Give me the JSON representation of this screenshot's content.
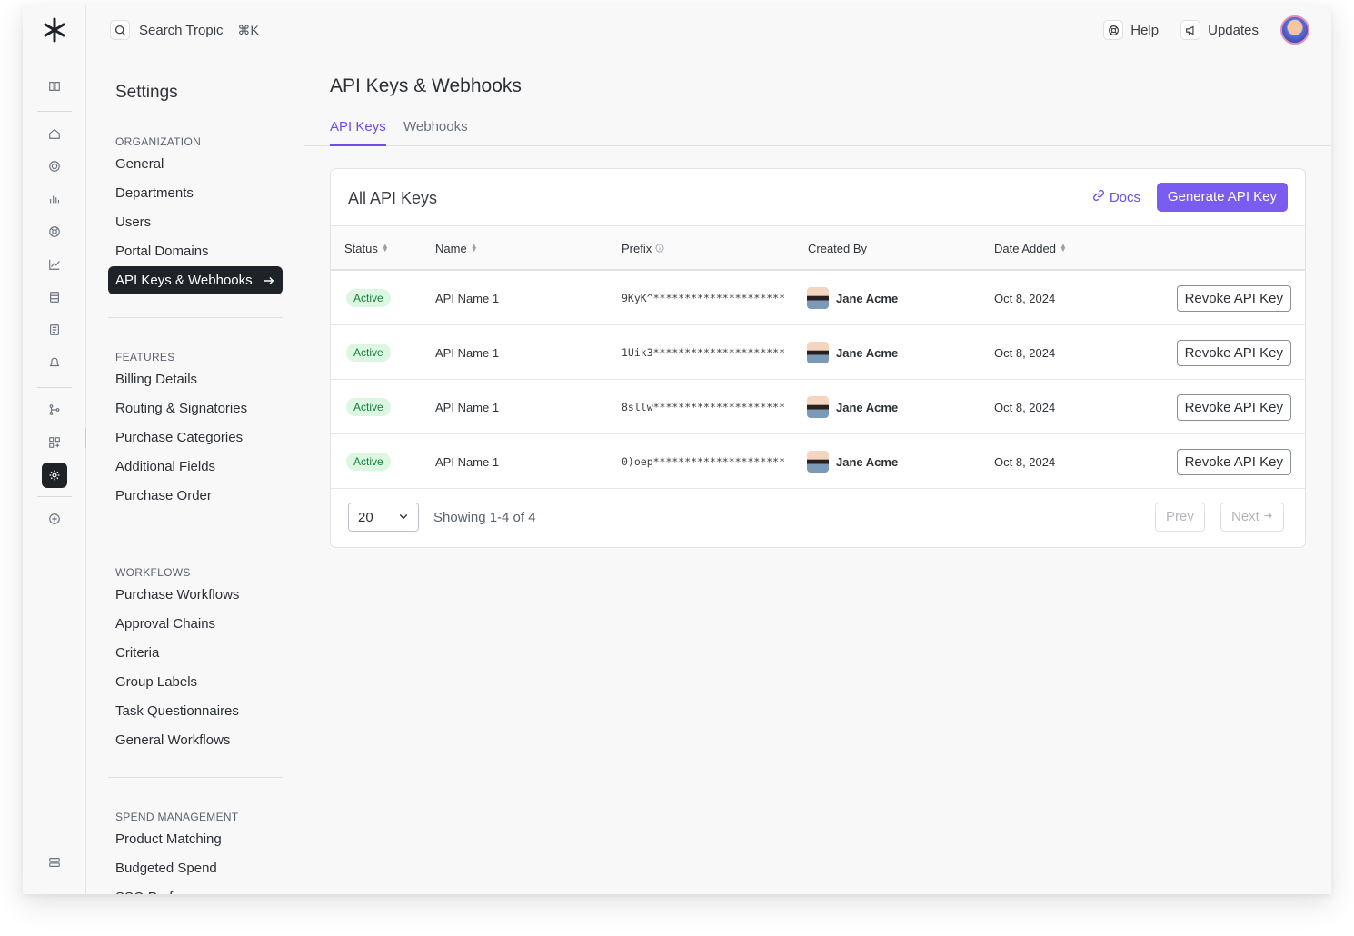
{
  "search": {
    "label": "Search Tropic",
    "shortcut": "⌘K"
  },
  "topbar": {
    "help": "Help",
    "updates": "Updates"
  },
  "settings": {
    "title": "Settings",
    "sections": [
      {
        "title": "ORGANIZATION",
        "items": [
          "General",
          "Departments",
          "Users",
          "Portal Domains",
          "API Keys & Webhooks"
        ]
      },
      {
        "title": "FEATURES",
        "items": [
          "Billing Details",
          "Routing & Signatories",
          "Purchase Categories",
          "Additional Fields",
          "Purchase Order"
        ]
      },
      {
        "title": "WORKFLOWS",
        "items": [
          "Purchase Workflows",
          "Approval Chains",
          "Criteria",
          "Group Labels",
          "Task Questionnaires",
          "General Workflows"
        ]
      },
      {
        "title": "SPEND MANAGEMENT",
        "items": [
          "Product Matching",
          "Budgeted Spend",
          "SSO Preferences"
        ]
      }
    ],
    "active_item": "API Keys & Webhooks"
  },
  "main": {
    "title": "API Keys & Webhooks",
    "tabs": [
      "API Keys",
      "Webhooks"
    ],
    "active_tab": "API Keys"
  },
  "card": {
    "title": "All API Keys",
    "docs_label": "Docs",
    "generate_label": "Generate API Key",
    "columns": [
      "Status",
      "Name",
      "Prefix",
      "Created By",
      "Date Added"
    ],
    "rows": [
      {
        "status": "Active",
        "name": "API Name 1",
        "prefix": "9KyK^*********************",
        "created_by": "Jane Acme",
        "date": "Oct 8, 2024",
        "action": "Revoke API Key"
      },
      {
        "status": "Active",
        "name": "API Name 1",
        "prefix": "1Uik3*********************",
        "created_by": "Jane Acme",
        "date": "Oct 8, 2024",
        "action": "Revoke API Key"
      },
      {
        "status": "Active",
        "name": "API Name 1",
        "prefix": "8sllw*********************",
        "created_by": "Jane Acme",
        "date": "Oct 8, 2024",
        "action": "Revoke API Key"
      },
      {
        "status": "Active",
        "name": "API Name 1",
        "prefix": "0)oep*********************",
        "created_by": "Jane Acme",
        "date": "Oct 8, 2024",
        "action": "Revoke API Key"
      }
    ],
    "pagination": {
      "per_page": "20",
      "showing": "Showing 1-4 of 4",
      "prev": "Prev",
      "next": "Next"
    }
  },
  "colors": {
    "accent": "#7b5cf0",
    "active_badge_bg": "#dcf6e2",
    "active_badge_text": "#16803c",
    "dark": "#1f2328"
  }
}
